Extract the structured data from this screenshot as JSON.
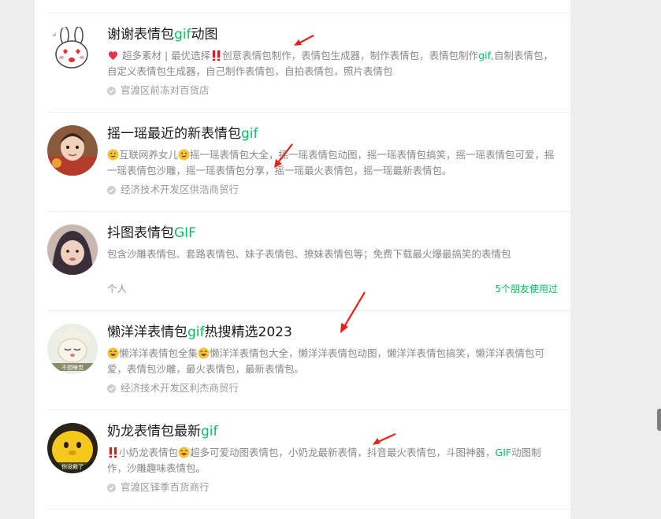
{
  "items": [
    {
      "title_pre": "谢谢表情包",
      "title_hl": "gif",
      "title_post": "动图",
      "desc_parts": [
        "超多素材 | 最优选择",
        "创意表情包制作，表情包生成器，制作表情包，表情包制作",
        "gif",
        ",自制表情包，自定义表情包生成器，自己制作表情包，自拍表情包，照片表情包"
      ],
      "meta": "官渡区前冻对百货店",
      "friends": ""
    },
    {
      "title_pre": "摇一瑶最近的新表情包",
      "title_hl": "gif",
      "title_post": "",
      "desc_parts": [
        "互联网养女儿",
        "摇一瑶表情包大全，摇一瑶表情包动图，摇一瑶表情包搞笑，摇一瑶表情包可爱，摇一瑶表情包沙雕，摇一瑶表情包分享，摇一瑶最火表情包，摇一瑶最新表情包。"
      ],
      "meta": "经济技术开发区供浩商贸行",
      "friends": ""
    },
    {
      "title_pre": "抖图表情包",
      "title_hl": "GIF",
      "title_post": "",
      "desc": "包含沙雕表情包、套路表情包、妹子表情包、撩妹表情包等；免费下载最火爆最搞笑的表情包",
      "meta": "个人",
      "friends": "5个朋友使用过"
    },
    {
      "title_pre": "懒洋洋表情包",
      "title_hl": "gif",
      "title_post": "热搜精选2023",
      "desc_parts": [
        "懒洋洋表情包全集",
        "懒洋洋表情包大全，懒洋洋表情包动图，懒洋洋表情包搞笑，懒洋洋表情包可爱，表情包沙雕，最火表情包，最新表情包。"
      ],
      "meta": "经济技术开发区利杰商贸行",
      "friends": ""
    },
    {
      "title_pre": "奶龙表情包最新",
      "title_hl": "gif",
      "title_post": "",
      "desc_parts": [
        "小奶龙表情包",
        "超多可爱动图表情包，小奶龙最新表情，抖音最火表情包，斗图神器，",
        "GIF",
        "动图制作，沙雕趣味表情包。"
      ],
      "meta": "官渡区铎季百货商行",
      "friends": ""
    }
  ],
  "avatar_text": {
    "item4": "不想睡觉",
    "item5": "你没救了"
  },
  "colors": {
    "accent": "#07c160",
    "arrow": "#e8221b"
  }
}
